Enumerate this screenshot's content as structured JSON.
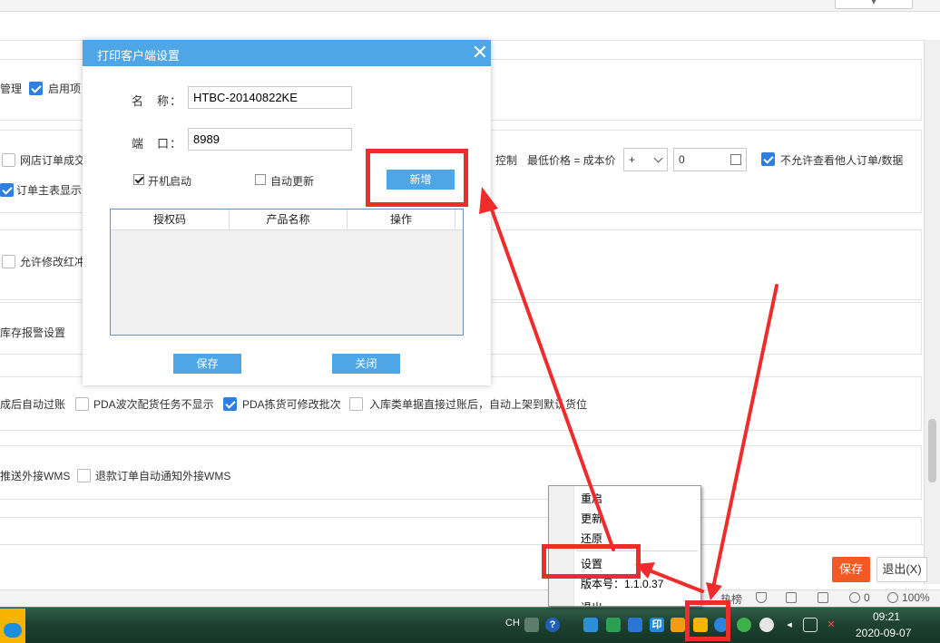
{
  "background": {
    "row1": {
      "label_a": "管理",
      "label_b": "启用项"
    },
    "row2": {
      "left_check": "网店订单成交",
      "control_tail": "控制",
      "min_price_label": "最低价格 = 成本价",
      "operator_value": "+",
      "number_value": "0",
      "no_view_label": "不允许查看他人订单/数据"
    },
    "row3": {
      "label": "订单主表显示"
    },
    "row4": {
      "label": "允许修改红冲"
    },
    "row5": {
      "label": "库存报警设置"
    },
    "row6": {
      "label_a": "成后自动过账",
      "label_b": "PDA波次配货任务不显示",
      "label_c": "PDA拣货可修改批次",
      "label_d": "入库类单据直接过账后，自动上架到默认货位"
    },
    "row7": {
      "label_a": "推送外接WMS",
      "label_b": "退款订单自动通知外接WMS"
    },
    "save_button": "保存",
    "exit_button": "退出(X)",
    "status": {
      "hot": "热榜",
      "count": "0",
      "zoom": "100%"
    }
  },
  "dialog": {
    "title": "打印客户端设置",
    "close_icon": "close-icon",
    "name_label": "名　称：",
    "name_value": "HTBC-20140822KE",
    "port_label": "端　口：",
    "port_value": "8989",
    "autostart_label": "开机启动",
    "autostart_checked": true,
    "autoupdate_label": "自动更新",
    "autoupdate_checked": false,
    "add_button": "新增",
    "grid_headers": [
      "授权码",
      "产品名称",
      "操作"
    ],
    "save_button": "保存",
    "close_button": "关闭"
  },
  "context_menu": {
    "items": [
      "重启",
      "更新",
      "还原",
      "设置",
      "版本号：1.1.0.37",
      "退出"
    ]
  },
  "taskbar": {
    "lang": "CH",
    "time": "09:21",
    "date": "2020-09-07"
  },
  "colors": {
    "dialog_blue": "#4ea6e6",
    "annotation_red": "#ee2c2c",
    "save_orange": "#f15a22",
    "checkbox_blue": "#2f7fe0"
  }
}
